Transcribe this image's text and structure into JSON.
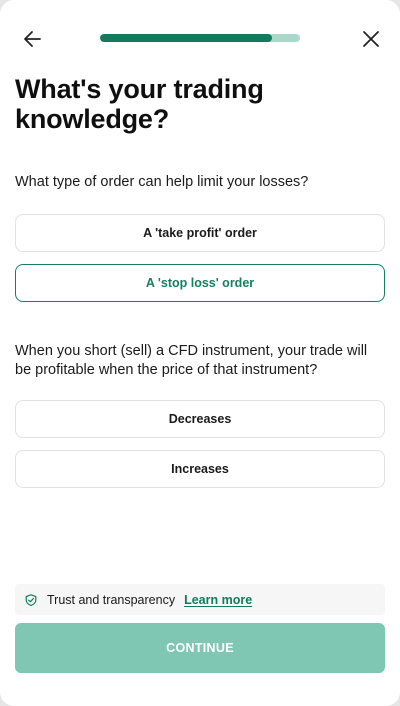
{
  "header": {
    "back_icon": "arrow-left-icon",
    "close_icon": "close-icon",
    "progress": 0.86,
    "progress_color": "#127b5e",
    "progress_track_color": "#a9d8c8"
  },
  "title": "What's your trading knowledge?",
  "questions": [
    {
      "text": "What type of order can help limit your losses?",
      "options": [
        {
          "label": "A 'take profit' order",
          "selected": false
        },
        {
          "label": "A 'stop loss' order",
          "selected": true
        }
      ]
    },
    {
      "text": "When you short (sell) a CFD instrument, your trade will be profitable when the price of that instrument?",
      "options": [
        {
          "label": "Decreases",
          "selected": false
        },
        {
          "label": "Increases",
          "selected": false
        }
      ]
    }
  ],
  "trust_bar": {
    "icon": "shield-check-icon",
    "text": "Trust and transparency",
    "link_label": "Learn more"
  },
  "continue_button": {
    "label": "CONTINUE",
    "enabled": false,
    "color": "#7fc6b3"
  },
  "accent_color": "#15805f"
}
